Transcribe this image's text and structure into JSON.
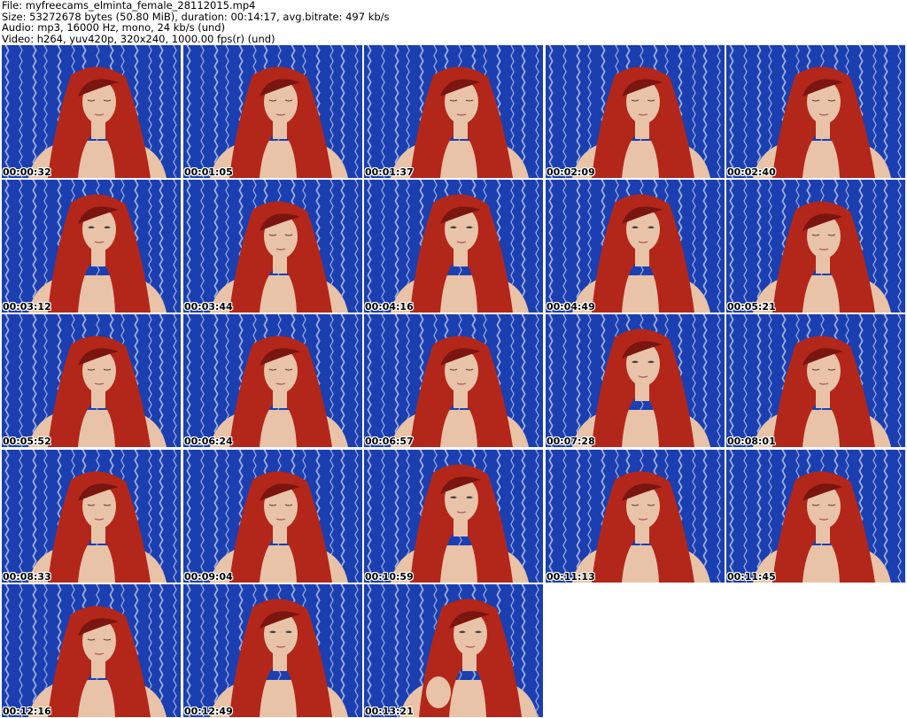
{
  "header": {
    "file_line": "File: myfreecams_elminta_female_28112015.mp4",
    "size_line": "Size: 53272678 bytes (50.80 MiB), duration: 00:14:17, avg.bitrate: 497 kb/s",
    "audio_line": "Audio: mp3, 16000 Hz, mono, 24 kb/s (und)",
    "video_line": "Video: h264, yuv420p, 320x240, 1000.00 fps(r) (und)"
  },
  "colors": {
    "background": "#ffffff",
    "curtain_blue": "#1b3fb0",
    "curtain_stripe": "#c9d4ee",
    "hair_red": "#b3261a",
    "skin": "#e9c3a8"
  },
  "thumbnails": [
    {
      "timestamp": "00:00:32",
      "pose": "looking-down"
    },
    {
      "timestamp": "00:01:05",
      "pose": "looking-down"
    },
    {
      "timestamp": "00:01:37",
      "pose": "looking-down"
    },
    {
      "timestamp": "00:02:09",
      "pose": "looking-down"
    },
    {
      "timestamp": "00:02:40",
      "pose": "looking-down"
    },
    {
      "timestamp": "00:03:12",
      "pose": "facing-camera"
    },
    {
      "timestamp": "00:03:44",
      "pose": "looking-down"
    },
    {
      "timestamp": "00:04:16",
      "pose": "facing-camera"
    },
    {
      "timestamp": "00:04:49",
      "pose": "facing-camera"
    },
    {
      "timestamp": "00:05:21",
      "pose": "looking-down"
    },
    {
      "timestamp": "00:05:52",
      "pose": "looking-down"
    },
    {
      "timestamp": "00:06:24",
      "pose": "looking-down"
    },
    {
      "timestamp": "00:06:57",
      "pose": "looking-down"
    },
    {
      "timestamp": "00:07:28",
      "pose": "facing-camera"
    },
    {
      "timestamp": "00:08:01",
      "pose": "looking-down"
    },
    {
      "timestamp": "00:08:33",
      "pose": "looking-down"
    },
    {
      "timestamp": "00:09:04",
      "pose": "looking-down"
    },
    {
      "timestamp": "00:10:59",
      "pose": "facing-camera"
    },
    {
      "timestamp": "00:11:13",
      "pose": "looking-down"
    },
    {
      "timestamp": "00:11:45",
      "pose": "looking-down"
    },
    {
      "timestamp": "00:12:16",
      "pose": "looking-down"
    },
    {
      "timestamp": "00:12:49",
      "pose": "facing-camera"
    },
    {
      "timestamp": "00:13:21",
      "pose": "hand-raised"
    }
  ]
}
